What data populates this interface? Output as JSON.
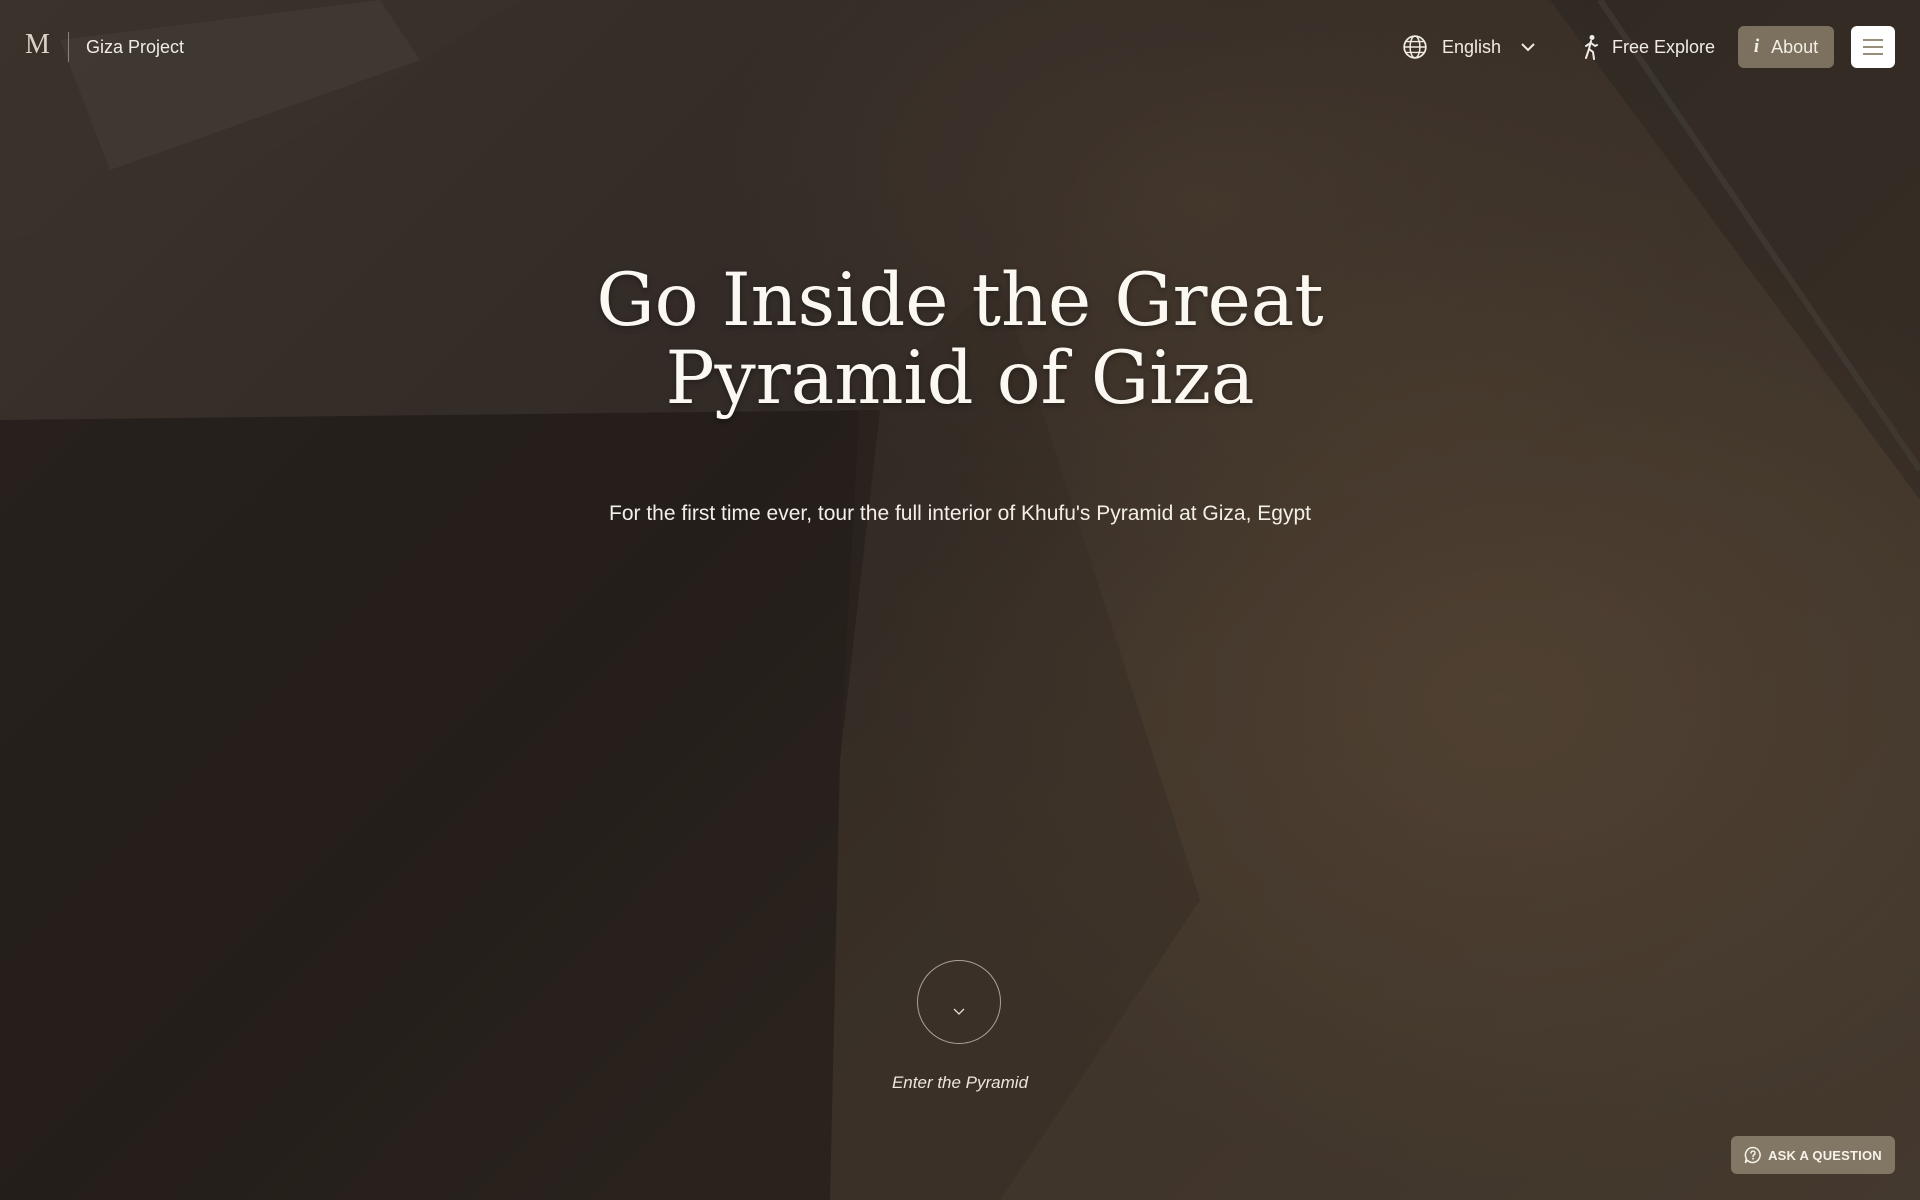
{
  "header": {
    "logo_text": "M",
    "brand": "Giza Project",
    "language": {
      "selected": "English",
      "icon": "globe-icon",
      "dropdown_icon": "chevron-down-icon"
    },
    "explore": {
      "label": "Free Explore",
      "icon": "walking-person-icon"
    },
    "about": {
      "label": "About",
      "icon_glyph": "i"
    },
    "menu": {
      "icon": "hamburger-menu-icon"
    }
  },
  "hero": {
    "title_line1": "Go Inside the Great",
    "title_line2": "Pyramid of Giza",
    "subtitle": "For the first time ever, tour the full interior of Khufu's Pyramid at Giza, Egypt",
    "enter_label": "Enter the Pyramid"
  },
  "help": {
    "ask_label": "ASK A QUESTION",
    "icon": "chat-question-icon"
  },
  "colors": {
    "button_bg": "#8a7e6a",
    "text_light": "#fbf8f2"
  }
}
